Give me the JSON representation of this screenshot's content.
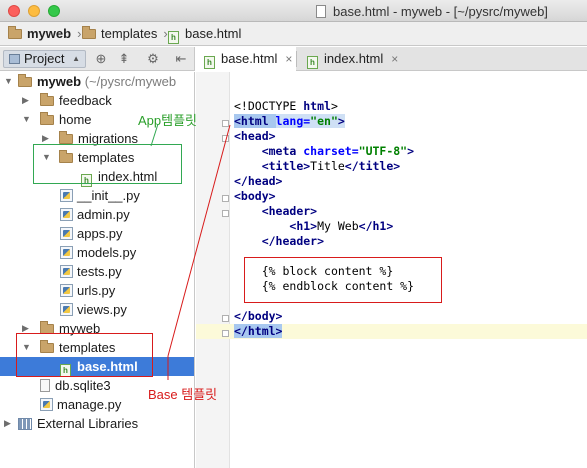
{
  "window": {
    "title": "base.html - myweb - [~/pysrc/myweb]",
    "traffic_lights": {
      "close": "#fc605c",
      "minimize": "#fdbc40",
      "zoom": "#34c84a"
    }
  },
  "breadcrumb": [
    {
      "label": "myweb",
      "icon": "folder-icon"
    },
    {
      "label": "templates",
      "icon": "folder-icon"
    },
    {
      "label": "base.html",
      "icon": "html-file-icon"
    }
  ],
  "project_toolbar": {
    "view_selector": "Project",
    "tools": [
      "target-icon",
      "collapse-icon",
      "gear-icon",
      "hide-icon"
    ]
  },
  "tabs": [
    {
      "label": "base.html",
      "active": true,
      "close": "×"
    },
    {
      "label": "index.html",
      "active": false,
      "close": "×"
    }
  ],
  "tree": [
    {
      "label": "myweb",
      "suffix": "(~/pysrc/myweb",
      "type": "folder",
      "expanded": true,
      "bold": true
    },
    {
      "label": "feedback",
      "type": "folder",
      "expanded": false
    },
    {
      "label": "home",
      "type": "folder",
      "expanded": true
    },
    {
      "label": "migrations",
      "type": "folder",
      "expanded": false
    },
    {
      "label": "templates",
      "type": "folder",
      "expanded": true
    },
    {
      "label": "index.html",
      "type": "html"
    },
    {
      "label": "__init__.py",
      "type": "python"
    },
    {
      "label": "admin.py",
      "type": "python"
    },
    {
      "label": "apps.py",
      "type": "python"
    },
    {
      "label": "models.py",
      "type": "python"
    },
    {
      "label": "tests.py",
      "type": "python"
    },
    {
      "label": "urls.py",
      "type": "python"
    },
    {
      "label": "views.py",
      "type": "python"
    },
    {
      "label": "myweb",
      "type": "folder",
      "expanded": false
    },
    {
      "label": "templates",
      "type": "folder",
      "expanded": true
    },
    {
      "label": "base.html",
      "type": "html",
      "selected": true
    },
    {
      "label": "db.sqlite3",
      "type": "db"
    },
    {
      "label": "manage.py",
      "type": "python"
    },
    {
      "label": "External Libraries",
      "type": "library",
      "expanded": false
    }
  ],
  "code": {
    "doctype": "<!DOCTYPE ",
    "doctype_name": "html",
    "doctype_close": ">",
    "html_open": "<html ",
    "html_attr": "lang=",
    "html_val": "\"en\"",
    "html_close": ">",
    "head_open": "<head>",
    "meta_open": "<meta ",
    "meta_attr": "charset=",
    "meta_val": "\"UTF-8\"",
    "meta_close": ">",
    "title_open": "<title>",
    "title_text": "Title",
    "title_close": "</title>",
    "head_close": "</head>",
    "body_open": "<body>",
    "header_open": "<header>",
    "h1_open": "<h1>",
    "h1_text": "My Web",
    "h1_close": "</h1>",
    "header_close": "</header>",
    "block_start": "{% block content %}",
    "block_end": "{% endblock content %}",
    "body_close": "</body>",
    "html_end": "</html>"
  },
  "annotations": {
    "app_template": "App템플릿",
    "base_template": "Base 템플릿",
    "green": "#32a852",
    "red": "#d81b1b"
  }
}
